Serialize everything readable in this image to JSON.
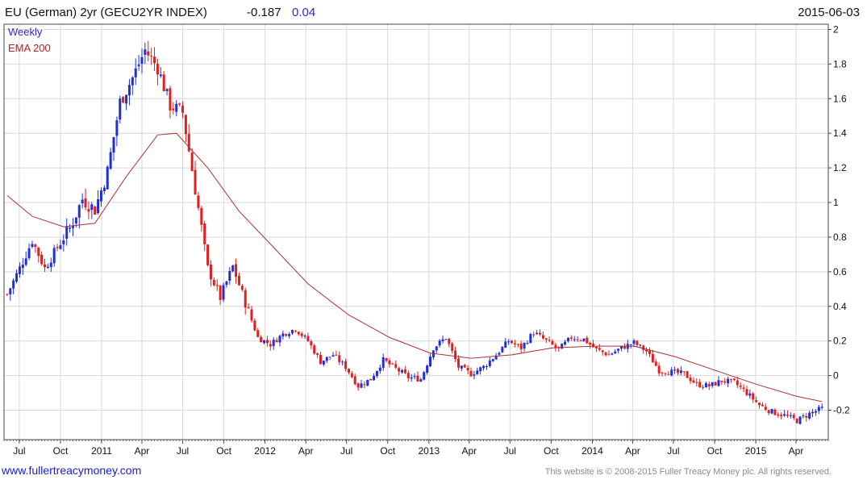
{
  "header": {
    "title": "EU (German) 2yr (GECU2YR INDEX)",
    "last": "-0.187",
    "change": "0.04",
    "date": "2015-06-03"
  },
  "legend": {
    "series1": "Weekly",
    "series2": "EMA 200"
  },
  "footer": {
    "website": "www.fullertreacymoney.com",
    "copyright": "This website is © 2008-2015 Fuller Treacy Money plc. All rights reserved."
  },
  "colors": {
    "up": "#1f2fd8",
    "down": "#e02020",
    "ema": "#b03030",
    "grid": "#d8d8d8"
  },
  "chart_data": {
    "type": "candlestick",
    "y_axis_side": "right",
    "ylim": [
      -0.37,
      2.03
    ],
    "y_ticks": [
      -0.2,
      0,
      0.2,
      0.4,
      0.6,
      0.8,
      1,
      1.2,
      1.4,
      1.6,
      1.8,
      2
    ],
    "y_tick_labels": [
      "-0.2",
      "0",
      "0.2",
      "0.4",
      "0.6",
      "0.8",
      "1",
      "1.2",
      "1.4",
      "1.6",
      "1.8",
      "2"
    ],
    "x_tick_labels": [
      "Jul",
      "Oct",
      "2011",
      "Apr",
      "Jul",
      "Oct",
      "2012",
      "Apr",
      "Jul",
      "Oct",
      "2013",
      "Apr",
      "Jul",
      "Oct",
      "2014",
      "Apr",
      "Jul",
      "Oct",
      "2015",
      "Apr"
    ],
    "grid": true,
    "series": [
      {
        "name": "Weekly",
        "style": "candlestick",
        "weekly_close_approx": [
          [
            "2010-06-04",
            0.47
          ],
          [
            "2010-07-02",
            0.62
          ],
          [
            "2010-07-30",
            0.78
          ],
          [
            "2010-08-27",
            0.62
          ],
          [
            "2010-09-24",
            0.74
          ],
          [
            "2010-10-22",
            0.85
          ],
          [
            "2010-11-19",
            1.02
          ],
          [
            "2010-12-17",
            0.96
          ],
          [
            "2011-01-14",
            1.18
          ],
          [
            "2011-02-11",
            1.58
          ],
          [
            "2011-03-11",
            1.72
          ],
          [
            "2011-04-08",
            1.88
          ],
          [
            "2011-05-06",
            1.78
          ],
          [
            "2011-06-03",
            1.56
          ],
          [
            "2011-07-01",
            1.52
          ],
          [
            "2011-07-29",
            1.08
          ],
          [
            "2011-08-26",
            0.62
          ],
          [
            "2011-09-23",
            0.45
          ],
          [
            "2011-10-21",
            0.63
          ],
          [
            "2011-11-18",
            0.42
          ],
          [
            "2011-12-16",
            0.22
          ],
          [
            "2012-01-13",
            0.18
          ],
          [
            "2012-02-10",
            0.24
          ],
          [
            "2012-03-09",
            0.27
          ],
          [
            "2012-04-06",
            0.2
          ],
          [
            "2012-05-04",
            0.08
          ],
          [
            "2012-06-01",
            0.12
          ],
          [
            "2012-06-29",
            0.05
          ],
          [
            "2012-07-27",
            -0.06
          ],
          [
            "2012-08-24",
            -0.02
          ],
          [
            "2012-09-21",
            0.09
          ],
          [
            "2012-10-19",
            0.04
          ],
          [
            "2012-11-16",
            -0.01
          ],
          [
            "2012-12-14",
            -0.02
          ],
          [
            "2013-01-11",
            0.16
          ],
          [
            "2013-02-08",
            0.22
          ],
          [
            "2013-03-08",
            0.05
          ],
          [
            "2013-04-05",
            0.01
          ],
          [
            "2013-05-03",
            0.05
          ],
          [
            "2013-05-31",
            0.12
          ],
          [
            "2013-06-28",
            0.2
          ],
          [
            "2013-07-26",
            0.16
          ],
          [
            "2013-08-23",
            0.25
          ],
          [
            "2013-09-20",
            0.2
          ],
          [
            "2013-10-18",
            0.15
          ],
          [
            "2013-11-15",
            0.22
          ],
          [
            "2013-12-13",
            0.21
          ],
          [
            "2014-01-10",
            0.15
          ],
          [
            "2014-02-07",
            0.12
          ],
          [
            "2014-03-07",
            0.16
          ],
          [
            "2014-04-04",
            0.19
          ],
          [
            "2014-05-02",
            0.14
          ],
          [
            "2014-05-30",
            0.03
          ],
          [
            "2014-06-27",
            0.02
          ],
          [
            "2014-07-25",
            0.01
          ],
          [
            "2014-08-22",
            -0.05
          ],
          [
            "2014-09-19",
            -0.06
          ],
          [
            "2014-10-17",
            -0.03
          ],
          [
            "2014-11-14",
            -0.04
          ],
          [
            "2014-12-12",
            -0.1
          ],
          [
            "2015-01-09",
            -0.17
          ],
          [
            "2015-02-06",
            -0.21
          ],
          [
            "2015-03-06",
            -0.23
          ],
          [
            "2015-04-03",
            -0.26
          ],
          [
            "2015-05-01",
            -0.22
          ],
          [
            "2015-05-29",
            -0.19
          ]
        ]
      },
      {
        "name": "EMA 200",
        "style": "line",
        "points": [
          [
            "2010-06-04",
            1.04
          ],
          [
            "2010-07-30",
            0.92
          ],
          [
            "2010-10-08",
            0.86
          ],
          [
            "2010-12-17",
            0.88
          ],
          [
            "2011-02-25",
            1.15
          ],
          [
            "2011-05-06",
            1.39
          ],
          [
            "2011-06-17",
            1.4
          ],
          [
            "2011-08-26",
            1.2
          ],
          [
            "2011-11-04",
            0.95
          ],
          [
            "2012-01-13",
            0.76
          ],
          [
            "2012-04-06",
            0.53
          ],
          [
            "2012-07-06",
            0.35
          ],
          [
            "2012-10-05",
            0.22
          ],
          [
            "2013-01-04",
            0.13
          ],
          [
            "2013-04-05",
            0.1
          ],
          [
            "2013-07-05",
            0.12
          ],
          [
            "2013-10-04",
            0.16
          ],
          [
            "2014-01-03",
            0.17
          ],
          [
            "2014-04-04",
            0.17
          ],
          [
            "2014-07-04",
            0.11
          ],
          [
            "2014-10-03",
            0.03
          ],
          [
            "2015-01-02",
            -0.05
          ],
          [
            "2015-04-03",
            -0.12
          ],
          [
            "2015-05-29",
            -0.15
          ]
        ]
      }
    ]
  }
}
